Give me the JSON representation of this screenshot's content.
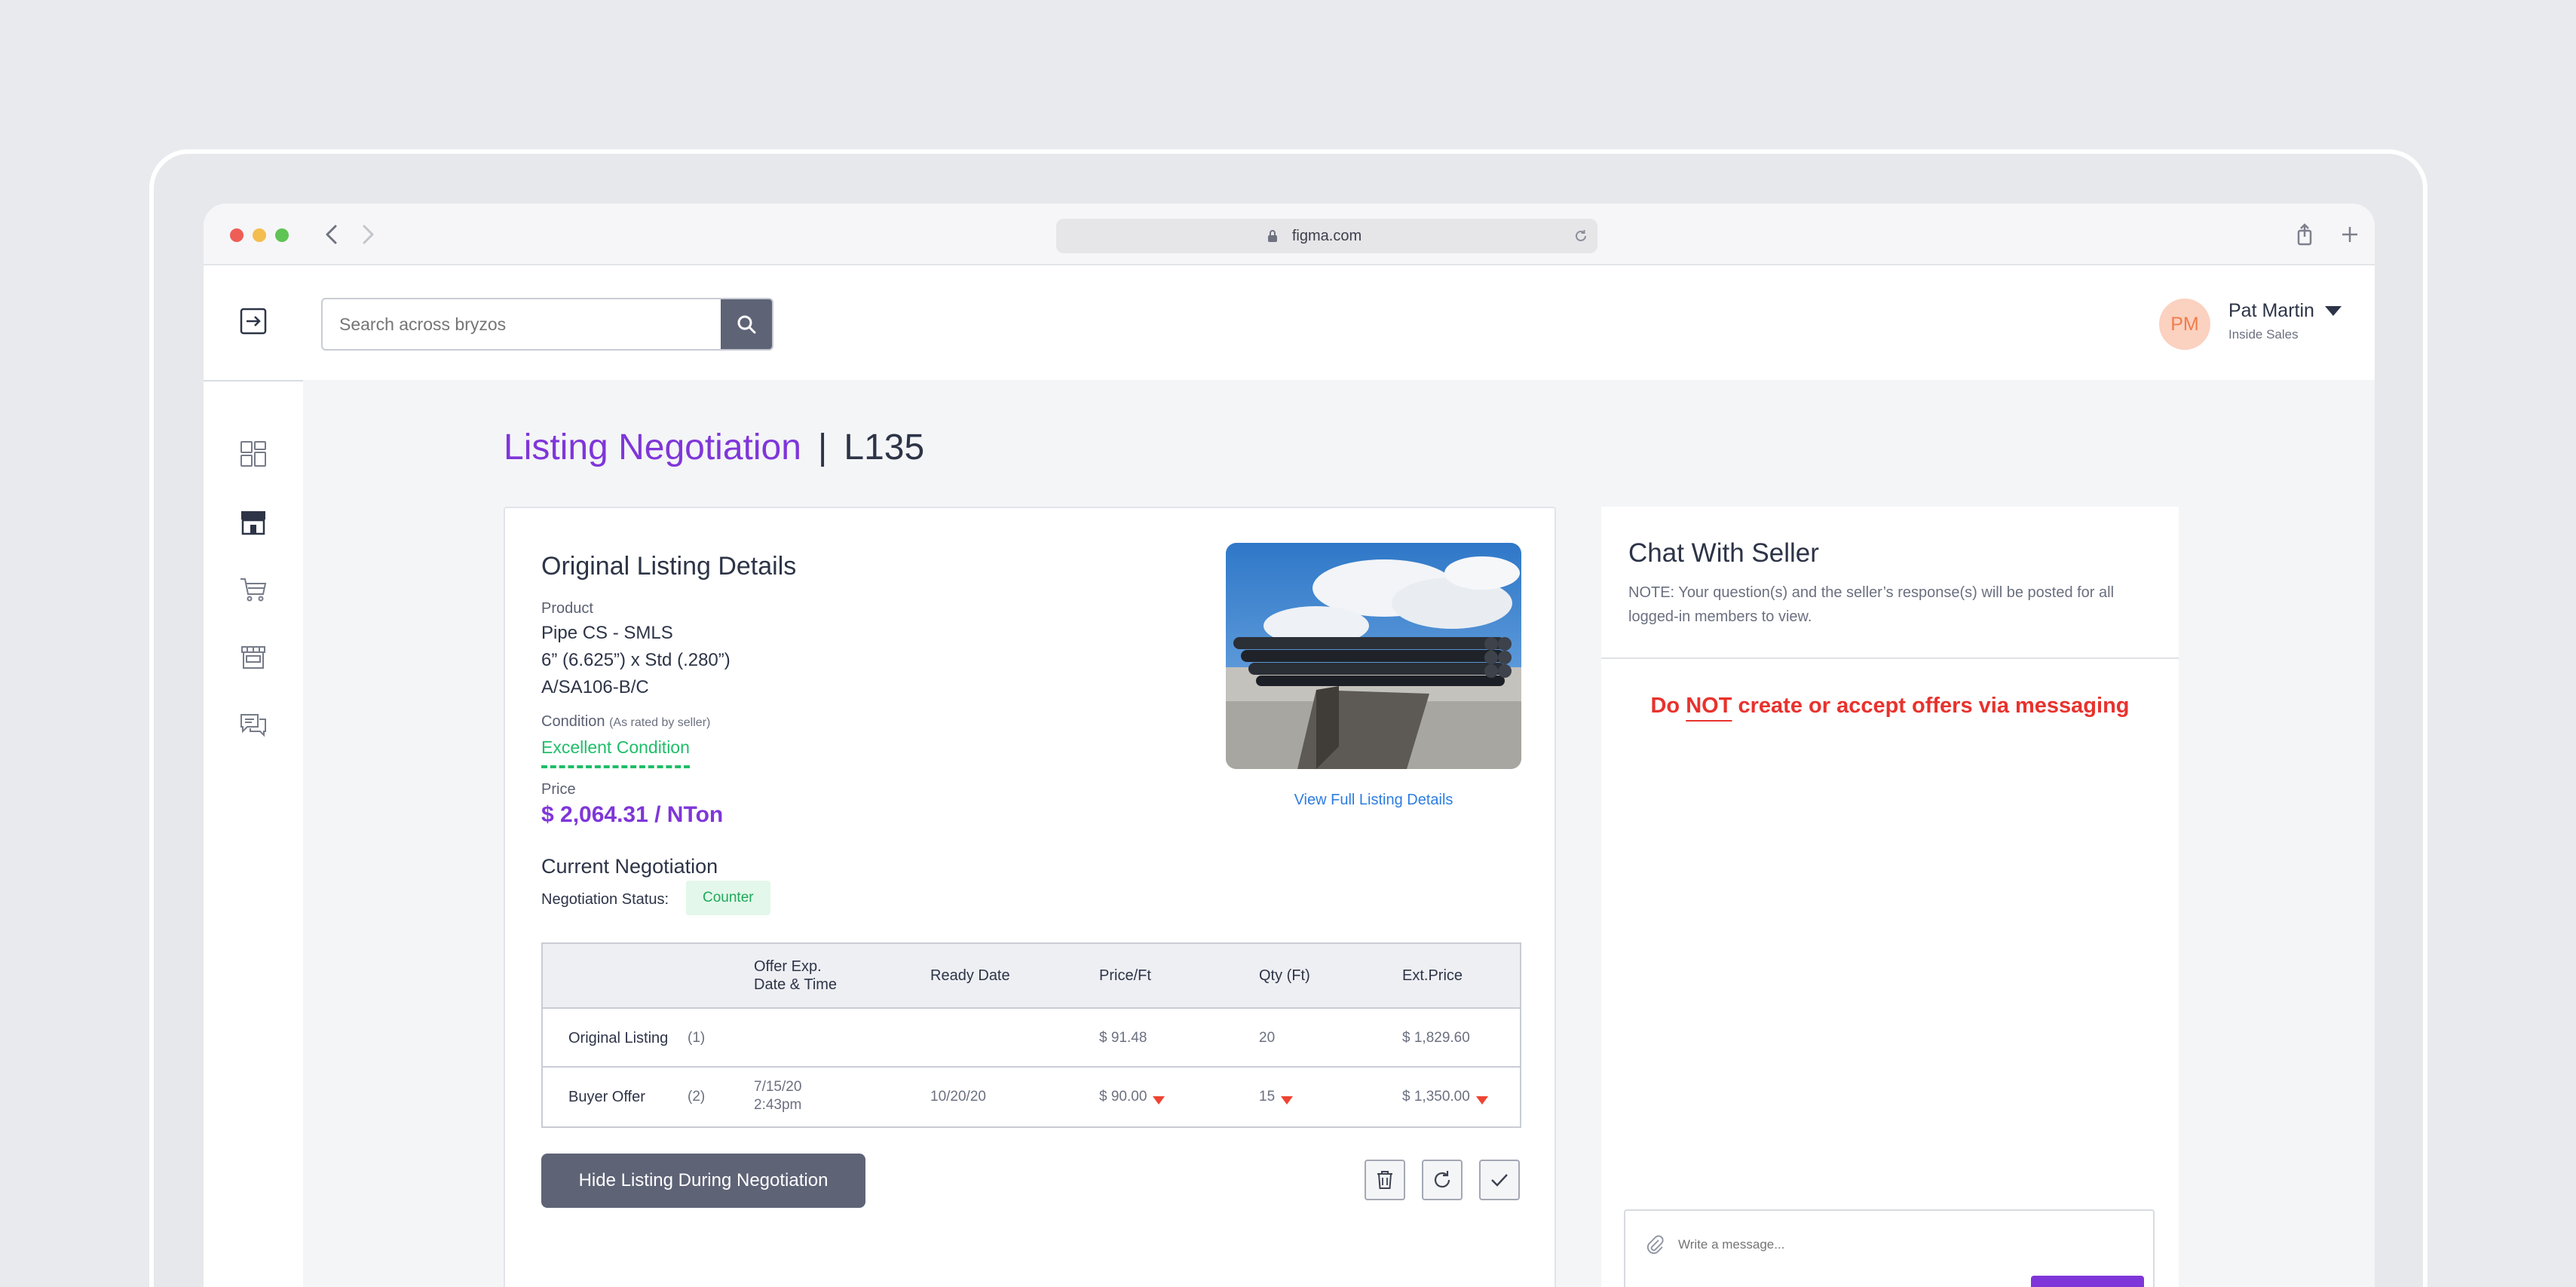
{
  "browser": {
    "url": "figma.com"
  },
  "topbar": {
    "search_placeholder": "Search across bryzos",
    "user": {
      "initials": "PM",
      "name": "Pat Martin",
      "role": "Inside Sales"
    }
  },
  "sidebar": {
    "items": [
      {
        "icon": "dashboard-icon"
      },
      {
        "icon": "storefront-icon"
      },
      {
        "icon": "cart-icon"
      },
      {
        "icon": "shop-icon"
      },
      {
        "icon": "chat-icon"
      }
    ]
  },
  "page": {
    "title": "Listing Negotiation",
    "separator": "|",
    "listing_id": "L135"
  },
  "listing": {
    "heading": "Original Listing Details",
    "product_label": "Product",
    "product_lines": [
      "Pipe CS - SMLS",
      "6” (6.625”) x Std (.280”)",
      "A/SA106-B/C"
    ],
    "condition_label": "Condition",
    "condition_note": "(As rated by seller)",
    "condition_value": "Excellent Condition",
    "price_label": "Price",
    "price_value": "$ 2,064.31 / NTon",
    "view_link": "View Full Listing Details"
  },
  "negotiation": {
    "heading": "Current Negotiation",
    "status_label": "Negotiation Status:",
    "status_value": "Counter",
    "columns": {
      "offer_exp_line1": "Offer Exp.",
      "offer_exp_line2": "Date & Time",
      "ready_date": "Ready Date",
      "price_ft": "Price/Ft",
      "qty": "Qty (Ft)",
      "ext_price": "Ext.Price"
    },
    "rows": [
      {
        "label": "Original Listing",
        "count": "(1)",
        "exp_date": "",
        "exp_time": "",
        "ready_date": "",
        "price_ft": "$ 91.48",
        "qty": "20",
        "ext_price": "$ 1,829.60"
      },
      {
        "label": "Buyer Offer",
        "count": "(2)",
        "exp_date": "7/15/20",
        "exp_time": "2:43pm",
        "ready_date": "10/20/20",
        "price_ft": "$ 90.00",
        "qty": "15",
        "ext_price": "$ 1,350.00"
      }
    ],
    "hide_button": "Hide Listing During Negotiation"
  },
  "chat": {
    "title": "Chat With Seller",
    "note": "NOTE: Your question(s) and the seller’s response(s) will be posted for all logged-in members to view.",
    "warning_pre": "Do",
    "warning_not": "NOT",
    "warning_post": "create or accept offers via messaging",
    "input_placeholder": "Write a message..."
  },
  "colors": {
    "accent": "#7f36d9",
    "success": "#1fbe69",
    "danger": "#e8322d",
    "link": "#2b7de0",
    "button_dark": "#5e6376"
  }
}
